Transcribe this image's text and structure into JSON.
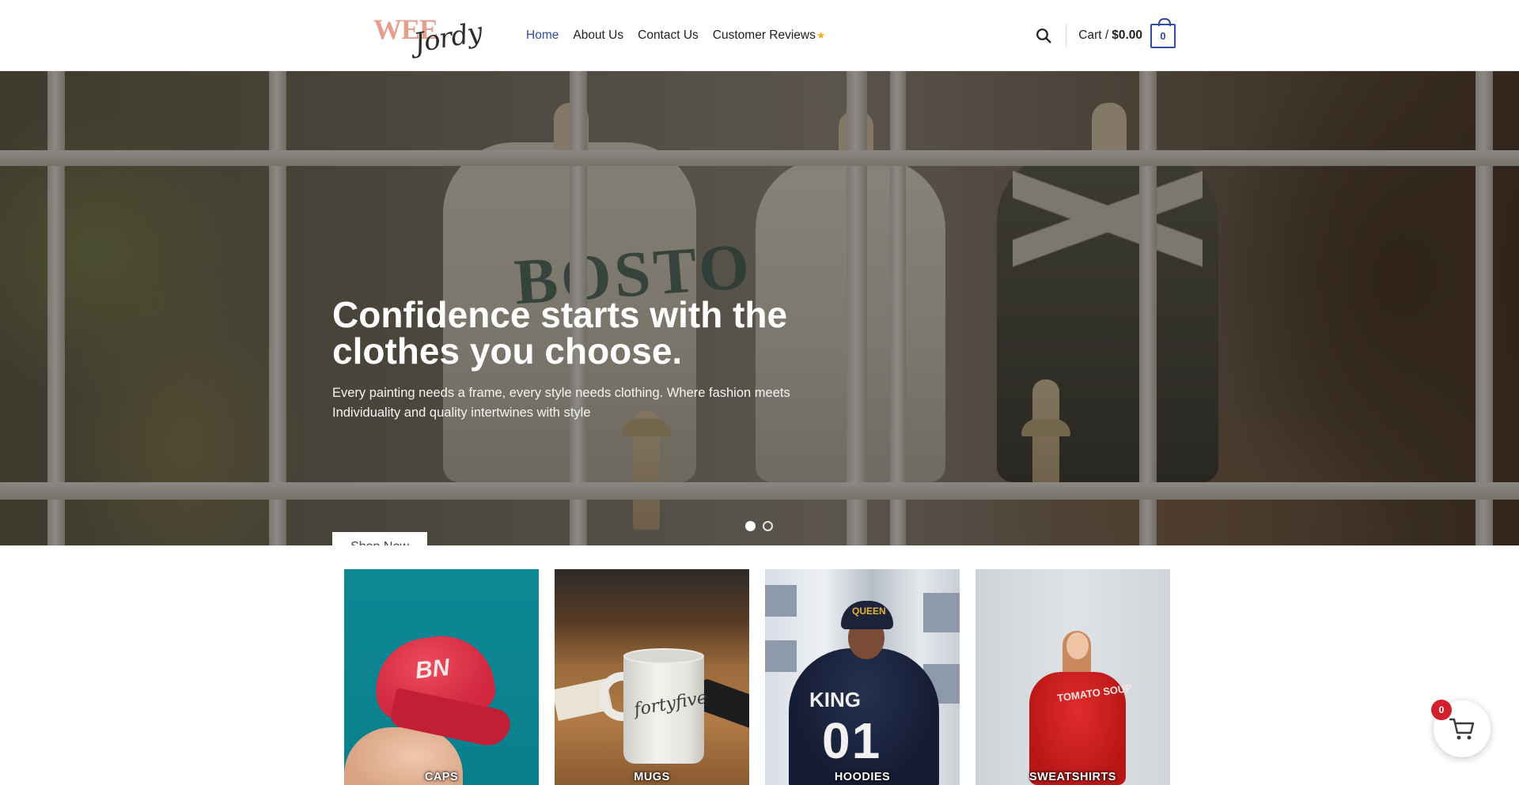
{
  "brand": {
    "logo_line1": "WEE",
    "logo_line2": "Jordy",
    "accent_color": "#2c4da0",
    "logo_color": "#e3a08f"
  },
  "nav": {
    "items": [
      {
        "label": "Home",
        "active": true
      },
      {
        "label": "About Us",
        "active": false
      },
      {
        "label": "Contact Us",
        "active": false
      },
      {
        "label": "Customer Reviews",
        "active": false,
        "icon": "star-icon"
      }
    ],
    "star_glyph": "★"
  },
  "header": {
    "search_icon": "search-icon",
    "cart_label": "Cart /",
    "cart_total": "$0.00",
    "cart_count": "0"
  },
  "hero": {
    "title": "Confidence starts with the clothes you choose.",
    "subtitle": "Every painting needs a frame, every style needs clothing. Where fashion meets Individuality and quality intertwines with style",
    "button_label": "Shop Now",
    "slides_total": 2,
    "slide_active": 1
  },
  "categories": [
    {
      "label": "CAPS"
    },
    {
      "label": "MUGS"
    },
    {
      "label": "HOODIES"
    },
    {
      "label": "SWEATSHIRTS"
    }
  ],
  "category_art": {
    "caps_logo": "BN",
    "mug_text": "fortyfive",
    "hoodie_hat_text": "QUEEN",
    "hoodie_back_text": "KING",
    "hoodie_number": "01",
    "sweatshirt_text": "TOMATO SOUP"
  },
  "floating_cart": {
    "icon": "shopping-cart-icon",
    "badge_count": "0",
    "badge_color": "#d2202f"
  }
}
